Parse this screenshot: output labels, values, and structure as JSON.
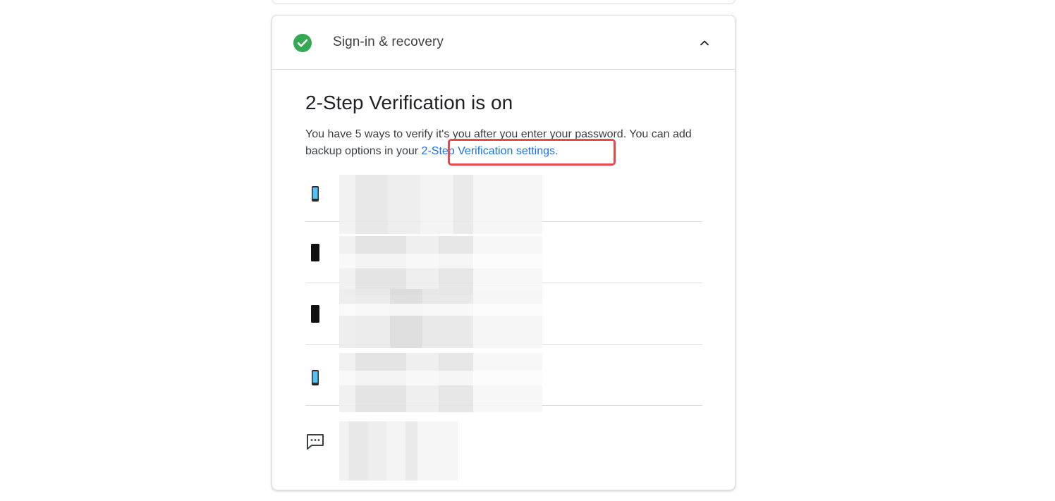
{
  "section": {
    "title": "Sign-in & recovery",
    "status_icon": "check-circle-icon",
    "toggle_icon": "chevron-up-icon"
  },
  "verification": {
    "heading": "2-Step Verification is on",
    "description_prefix": "You have 5 ways to verify it's you after you enter your password. You can add backup options in your ",
    "settings_link": "2-Step Verification settings."
  },
  "methods": [
    {
      "icon": "phone-icon"
    },
    {
      "icon": "phone-dark-icon"
    },
    {
      "icon": "phone-dark-icon"
    },
    {
      "icon": "phone-icon"
    },
    {
      "icon": "message-icon"
    }
  ],
  "colors": {
    "success": "#34a853",
    "link": "#1a73e8",
    "highlight": "#e5484d"
  }
}
